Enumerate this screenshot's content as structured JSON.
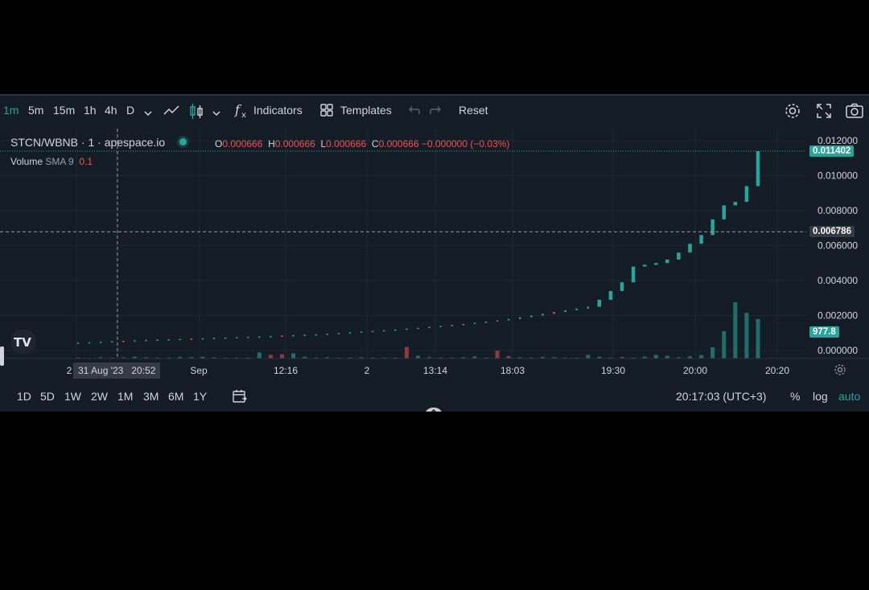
{
  "toolbar": {
    "intervals": [
      "1m",
      "5m",
      "15m",
      "1h",
      "4h",
      "D"
    ],
    "active_interval": "1m",
    "indicators_label": "Indicators",
    "templates_label": "Templates",
    "reset_label": "Reset"
  },
  "legend": {
    "symbol": "STCN/WBNB",
    "interval": "1",
    "source": "apespace.io",
    "o_key": "O",
    "o_val": "0.000666",
    "h_key": "H",
    "h_val": "0.000666",
    "l_key": "L",
    "l_val": "0.000666",
    "c_key": "C",
    "c_val": "0.000666 −0.000000 (−0.03%)",
    "volume_label": "Volume",
    "volume_sma": "SMA 9",
    "volume_value": "0.1"
  },
  "price_axis": {
    "ticks": [
      "0.012000",
      "0.010000",
      "0.008000",
      "0.006000",
      "0.004000",
      "0.002000",
      "0.000000"
    ],
    "last_price": "0.011402",
    "crosshair_price": "0.006786",
    "volume_label": "977.8"
  },
  "time_axis": {
    "labels": [
      "2",
      "Sep",
      "12:16",
      "2",
      "13:14",
      "18:03",
      "19:30",
      "20:00",
      "20:20"
    ],
    "crosshair_date": "31 Aug '23",
    "crosshair_time": "20:52"
  },
  "bottom": {
    "ranges": [
      "1D",
      "5D",
      "1W",
      "2W",
      "1M",
      "3M",
      "6M",
      "1Y"
    ],
    "clock": "20:17:03 (UTC+3)",
    "percent": "%",
    "log": "log",
    "auto": "auto"
  },
  "colors": {
    "up": "#26a69a",
    "down": "#ef5350",
    "background": "#141c26",
    "crosshair": "#9598a1"
  },
  "chart_data": {
    "type": "candlestick",
    "symbol": "STCN/WBNB",
    "ylim": [
      0,
      0.012
    ],
    "close_series": [
      0.00045,
      0.00047,
      0.0005,
      0.00053,
      0.00055,
      0.00058,
      0.0006,
      0.00062,
      0.00064,
      0.00066,
      0.00068,
      0.0007,
      0.00072,
      0.00074,
      0.00076,
      0.00078,
      0.0008,
      0.00082,
      0.00085,
      0.00088,
      0.0009,
      0.00093,
      0.00096,
      0.001,
      0.00104,
      0.00108,
      0.00112,
      0.00116,
      0.0012,
      0.00125,
      0.0013,
      0.00135,
      0.0014,
      0.00146,
      0.00152,
      0.00158,
      0.00165,
      0.00172,
      0.0018,
      0.0019,
      0.002,
      0.0021,
      0.0022,
      0.0023,
      0.0024,
      0.0025,
      0.0029,
      0.0034,
      0.0039,
      0.0048,
      0.0049,
      0.005,
      0.0052,
      0.0056,
      0.0061,
      0.0066,
      0.0075,
      0.0083,
      0.0085,
      0.0094,
      0.0114
    ],
    "up_flags": [
      1,
      1,
      1,
      1,
      0,
      1,
      1,
      1,
      1,
      1,
      0,
      1,
      1,
      1,
      1,
      1,
      1,
      1,
      0,
      1,
      1,
      1,
      1,
      1,
      1,
      1,
      1,
      1,
      1,
      1,
      1,
      1,
      1,
      1,
      1,
      1,
      1,
      1,
      1,
      1,
      1,
      1,
      0,
      1,
      1,
      1,
      1,
      1,
      1,
      1,
      1,
      1,
      1,
      1,
      1,
      1,
      1,
      1,
      1,
      1,
      1
    ],
    "volume_series": [
      30,
      20,
      40,
      25,
      35,
      60,
      40,
      30,
      30,
      50,
      45,
      55,
      35,
      25,
      30,
      30,
      200,
      120,
      140,
      170,
      60,
      30,
      40,
      25,
      30,
      40,
      30,
      25,
      30,
      380,
      90,
      40,
      30,
      30,
      40,
      70,
      30,
      260,
      80,
      40,
      30,
      50,
      40,
      30,
      25,
      120,
      60,
      30,
      50,
      30,
      60,
      120,
      90,
      40,
      70,
      110,
      370,
      900,
      1850,
      1500,
      1300
    ],
    "volume_up_flags": [
      1,
      1,
      1,
      1,
      1,
      1,
      1,
      1,
      1,
      1,
      1,
      1,
      1,
      1,
      1,
      1,
      1,
      0,
      0,
      1,
      1,
      1,
      1,
      1,
      1,
      1,
      1,
      1,
      1,
      0,
      1,
      1,
      1,
      1,
      1,
      1,
      1,
      0,
      0,
      1,
      1,
      1,
      1,
      1,
      1,
      1,
      1,
      1,
      1,
      1,
      1,
      1,
      1,
      1,
      1,
      1,
      1,
      1,
      1,
      1,
      1
    ],
    "volume_last": 977.8
  }
}
